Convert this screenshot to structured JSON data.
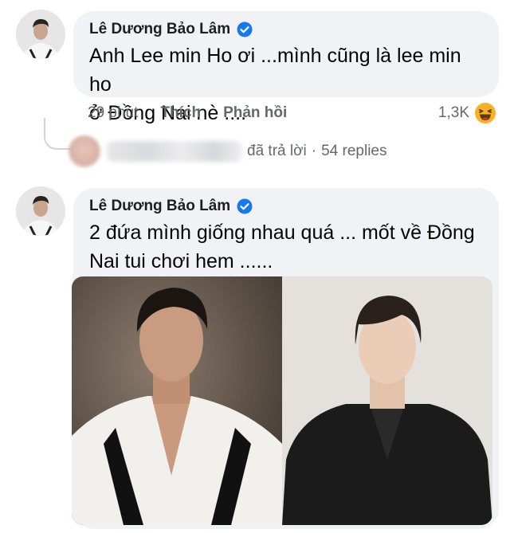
{
  "comments": [
    {
      "author": "Lê Dương Bảo Lâm",
      "verified_icon": "verified-badge-icon",
      "text": "Anh Lee min Ho ơi ...mình cũng là lee min ho\nở Đồng Nai nè ....",
      "time": "29 phút",
      "like_label": "Thích",
      "reply_label": "Phản hồi",
      "reaction_count": "1,3K",
      "reaction_icon": "haha-icon"
    },
    {
      "author": "Lê Dương Bảo Lâm",
      "verified_icon": "verified-badge-icon",
      "text": "2 đứa mình giống nhau quá ... mốt về Đồng\nNai tui chơi hem ......"
    }
  ],
  "replies": {
    "replied_text": "đã trả lời",
    "separator": "·",
    "count_text": "54 replies"
  },
  "colors": {
    "bubble": "#f0f2f5",
    "verified": "#1877f2",
    "secondary_text": "#65676b"
  }
}
